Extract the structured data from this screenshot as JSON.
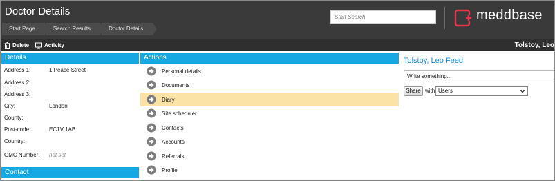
{
  "header": {
    "title": "Doctor Details",
    "breadcrumbs": [
      "Start Page",
      "Search Results",
      "Doctor Details"
    ],
    "search_placeholder": "Start Search",
    "logo_text": "meddbase",
    "logo_icon": "meddbase-logo-icon"
  },
  "toolbar": {
    "delete_label": "Delete",
    "activity_label": "Activity",
    "user_name": "Tolstoy, Leo"
  },
  "details": {
    "heading": "Details",
    "rows": [
      {
        "label": "Address 1:",
        "value": "1 Peace Street"
      },
      {
        "label": "Address 2:",
        "value": ""
      },
      {
        "label": "Address 3:",
        "value": ""
      },
      {
        "label": "City:",
        "value": "London"
      },
      {
        "label": "County:",
        "value": ""
      },
      {
        "label": "Post-code:",
        "value": "EC1V 1AB"
      },
      {
        "label": "Country:",
        "value": ""
      },
      {
        "label": "GMC Number:",
        "value": "not set"
      }
    ]
  },
  "contact": {
    "heading": "Contact"
  },
  "actions": {
    "heading": "Actions",
    "selected_index": 2,
    "items": [
      "Personal details",
      "Documents",
      "Diary",
      "Site scheduler",
      "Contacts",
      "Accounts",
      "Referrals",
      "Profile"
    ]
  },
  "feed": {
    "title": "Tolstoy, Leo Feed",
    "input_placeholder": "Write something...",
    "share_label": "Share",
    "with_label": "with",
    "audience_selected": "Users"
  },
  "colors": {
    "header_bg": "#3a3a3a",
    "accent_blue": "#16a8e2",
    "logo_red": "#e2374a",
    "selected_row": "#fbe3a8",
    "feed_title": "#1a8fd0"
  }
}
